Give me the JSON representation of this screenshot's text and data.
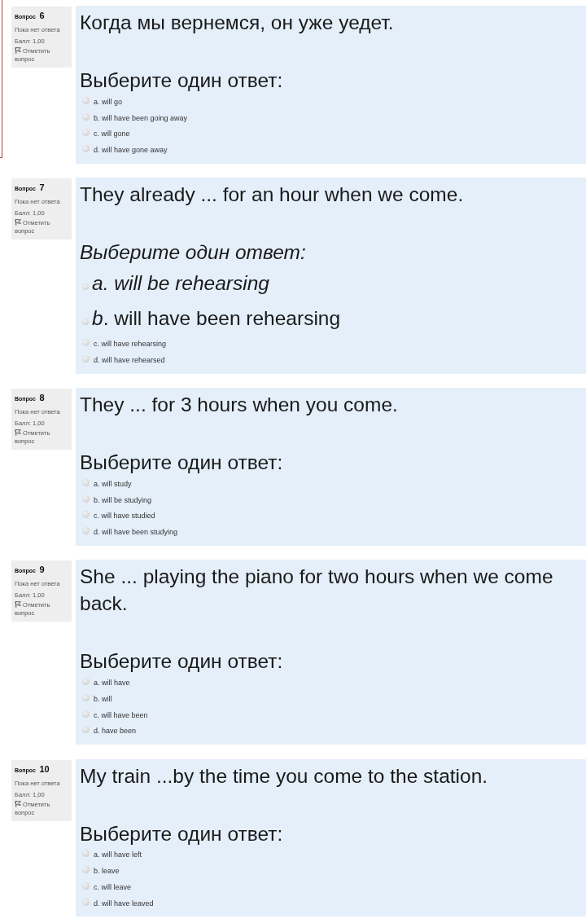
{
  "questions": [
    {
      "number_label": "Вопрос",
      "number": "6",
      "status": "Пока нет ответа",
      "score": "Балл: 1,00",
      "flag_label": "Отметить вопрос",
      "text": "Когда мы вернемся, он уже уедет.",
      "prompt": "Выберите один ответ:",
      "prompt_italic": false,
      "options": [
        {
          "kind": "small",
          "text": "a. will go",
          "selected": false
        },
        {
          "kind": "small",
          "text": "b. will have been going away",
          "selected": false
        },
        {
          "kind": "small",
          "text": "c. will gone",
          "selected": false
        },
        {
          "kind": "small",
          "text": "d. will have gone away",
          "selected": false
        }
      ]
    },
    {
      "number_label": "Вопрос",
      "number": "7",
      "status": "Пока нет ответа",
      "score": "Балл: 1,00",
      "flag_label": "Отметить вопрос",
      "text": "They already ... for an hour when we come.",
      "prompt": "Выберите один ответ:",
      "prompt_italic": true,
      "options": [
        {
          "kind": "large-italic",
          "text": "a. will be rehearsing",
          "selected": false
        },
        {
          "kind": "large",
          "text": "*b*. will have been rehearsing",
          "selected": false
        },
        {
          "kind": "small",
          "text": "c. will have rehearsing",
          "selected": false
        },
        {
          "kind": "small",
          "text": "d. will have rehearsed",
          "selected": false
        }
      ]
    },
    {
      "number_label": "Вопрос",
      "number": "8",
      "status": "Пока нет ответа",
      "score": "Балл: 1,00",
      "flag_label": "Отметить вопрос",
      "text": "They ... for 3 hours when you come.",
      "prompt": "Выберите один ответ:",
      "prompt_italic": false,
      "options": [
        {
          "kind": "small",
          "text": "a. will study",
          "selected": false
        },
        {
          "kind": "small",
          "text": "b. will be studying",
          "selected": false
        },
        {
          "kind": "small",
          "text": "c. will have studied",
          "selected": false
        },
        {
          "kind": "small",
          "text": "d. will have been studying",
          "selected": false
        }
      ]
    },
    {
      "number_label": "Вопрос",
      "number": "9",
      "status": "Пока нет ответа",
      "score": "Балл: 1,00",
      "flag_label": "Отметить вопрос",
      "text": "She ... playing the piano for two hours when we come back.",
      "prompt": "Выберите один ответ:",
      "prompt_italic": false,
      "options": [
        {
          "kind": "small",
          "text": "a. will have",
          "selected": false
        },
        {
          "kind": "small",
          "text": "b. will",
          "selected": false
        },
        {
          "kind": "small",
          "text": "c. will have been",
          "selected": false
        },
        {
          "kind": "small",
          "text": "d. have been",
          "selected": false
        }
      ]
    },
    {
      "number_label": "Вопрос",
      "number": "10",
      "status": "Пока нет ответа",
      "score": "Балл: 1,00",
      "flag_label": "Отметить вопрос",
      "text": "My train ...by the time you come to the station.",
      "prompt": "Выберите один ответ:",
      "prompt_italic": false,
      "options": [
        {
          "kind": "small",
          "text": "a. will have left",
          "selected": false
        },
        {
          "kind": "small",
          "text": "b. leave",
          "selected": false
        },
        {
          "kind": "small",
          "text": "c. will leave",
          "selected": false
        },
        {
          "kind": "small",
          "text": "d. will have leaved",
          "selected": false
        }
      ]
    }
  ]
}
